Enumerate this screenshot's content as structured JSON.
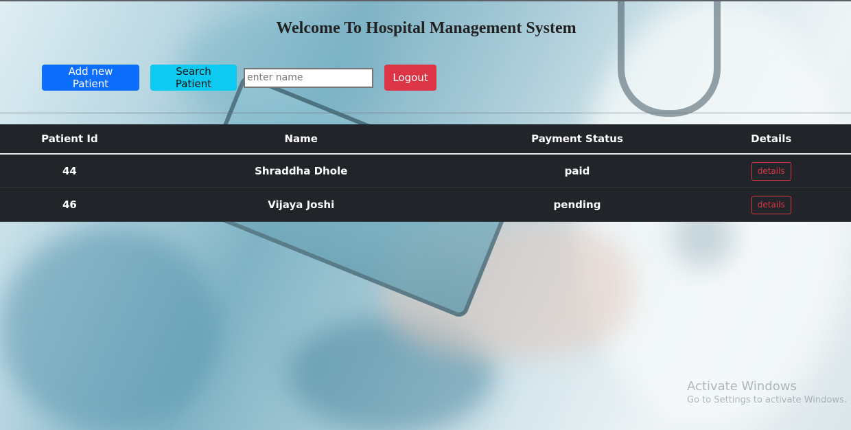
{
  "header": {
    "title": "Welcome To Hospital Management System"
  },
  "toolbar": {
    "add_label": "Add new Patient",
    "search_label": "Search Patient",
    "search_placeholder": "enter name",
    "search_value": "",
    "logout_label": "Logout"
  },
  "table": {
    "columns": [
      "Patient Id",
      "Name",
      "Payment Status",
      "Details"
    ],
    "rows": [
      {
        "id": "44",
        "name": "Shraddha Dhole",
        "payment": "paid",
        "action": "details"
      },
      {
        "id": "46",
        "name": "Vijaya Joshi",
        "payment": "pending",
        "action": "details"
      }
    ]
  },
  "watermark": {
    "title": "Activate Windows",
    "subtitle": "Go to Settings to activate Windows."
  },
  "colors": {
    "primary": "#0d6efd",
    "info": "#0dcaf0",
    "danger": "#dc3545",
    "table_dark": "#212529"
  }
}
